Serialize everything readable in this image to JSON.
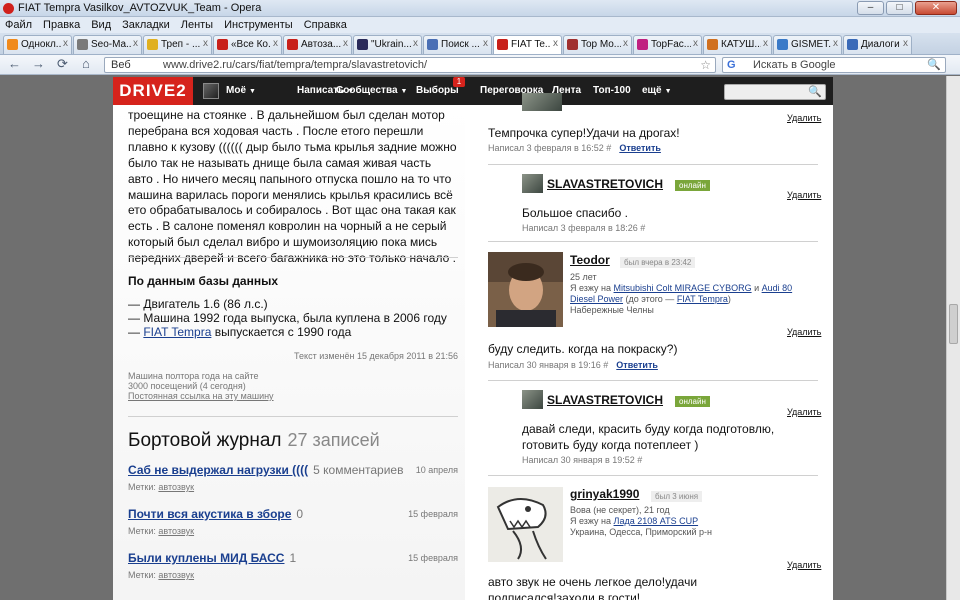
{
  "window": {
    "title": "FIAT Tempra Vasilkov_AVTOZVUK_Team - Opera",
    "min": "–",
    "max": "□",
    "close": "✕"
  },
  "menu": [
    "Файл",
    "Правка",
    "Вид",
    "Закладки",
    "Ленты",
    "Инструменты",
    "Справка"
  ],
  "tabs": [
    {
      "label": "Однокл...",
      "color": "#f08a1c"
    },
    {
      "label": "Seo-Ma...",
      "color": "#7a7a7a"
    },
    {
      "label": "Треп - ...",
      "color": "#e0b020"
    },
    {
      "label": "«Все Ко...",
      "color": "#c8201a"
    },
    {
      "label": "Автоза...",
      "color": "#c8201a"
    },
    {
      "label": "\"Ukrain...",
      "color": "#2a2a5a"
    },
    {
      "label": "Поиск ...",
      "color": "#4a6fb5"
    },
    {
      "label": "FIAT Te...",
      "color": "#c8201a",
      "active": true
    },
    {
      "label": "Top Mo...",
      "color": "#a03030"
    },
    {
      "label": "TopFac...",
      "color": "#c02080"
    },
    {
      "label": "КАТУШ...",
      "color": "#d07020"
    },
    {
      "label": "GISMET...",
      "color": "#3a7ac8"
    },
    {
      "label": "Диалоги",
      "color": "#3a6ab8"
    }
  ],
  "tab_close": "x",
  "addr": {
    "back": "←",
    "forward": "→",
    "reload": "⟳",
    "home": "⌂",
    "web_label": "Веб",
    "url": "www.drive2.ru/cars/fiat/tempra/tempra/slavastretovich/",
    "star": "☆"
  },
  "gsearch": {
    "engine": "G",
    "placeholder": "Искать в Google",
    "icon": "🔍"
  },
  "site_nav": {
    "logo": "DRIVE2",
    "items": [
      {
        "label": "Моё",
        "dropdown": true
      },
      {
        "label": "Написать",
        "dropdown": true
      },
      {
        "label": "Сообщества",
        "dropdown": true
      },
      {
        "label": "Выборы",
        "dropdown": false
      },
      {
        "label": "Переговорка",
        "dropdown": false
      },
      {
        "label": "Лента",
        "dropdown": false
      },
      {
        "label": "Топ-100",
        "dropdown": false
      },
      {
        "label": "ещё",
        "dropdown": true
      }
    ],
    "badge": "1",
    "caret": "▼",
    "search_icon": "🔍"
  },
  "left": {
    "description": "троещине на стоянке . В дальнейшом был сделан мотор перебрана вся ходовая часть . После етого перешли плавно к кузову (((((( дыр было тьма крылья задние можно было так не называть днище была самая живая часть авто . Но ничего месяц папыного отпуска пошло на то что машина варилась пороги менялись крылья красились всё ето обрабатывалось и собиралось . Вот щас она такая как есть . В салоне поменял ковролин на чорный а не серый который был сделал вибро и шумоизоляцию пока мись передних дверей и всего багажника но это только начало .",
    "db_heading": "По данным базы данных",
    "db_engine": "— Двигатель 1.6 (86 л.с.)",
    "db_year": "— Машина 1992 года выпуска, была куплена в 2006 году",
    "db_prod_dash": "— ",
    "db_prod_link": "FIAT Tempra",
    "db_prod_rest": " выпускается с 1990 года",
    "edited": "Текст изменён 15 декабря 2011 в 21:56",
    "stat1": "Машина полтора года на сайте",
    "stat2": "3000 посещений (4 сегодня)",
    "permalink": "Постоянная ссылка на эту машину",
    "journal_title": "Бортовой журнал",
    "journal_count": "27 записей",
    "posts": [
      {
        "title": "Саб не выдержал нагрузки ((((",
        "comments": "5 комментариев",
        "date": "10 апреля",
        "tags_label": "Метки: ",
        "tag": "автозвук"
      },
      {
        "title": "Почти вся акустика в зборе",
        "comments": "0",
        "date": "15 февраля",
        "tags_label": "Метки: ",
        "tag": "автозвук"
      },
      {
        "title": "Были куплены МИД БАСС",
        "comments": "1",
        "date": "15 февраля",
        "tags_label": "Метки: ",
        "tag": "автозвук"
      }
    ]
  },
  "right": {
    "delete": "Удалить",
    "reply": "Ответить",
    "c1": {
      "text": "Темпрочка супер!Удачи на дрогах!",
      "meta": "Написал 3 февраля в 16:52 #"
    },
    "c2": {
      "user": "SLAVASTRETOVICH",
      "status": "онлайн",
      "text": "Большое спасибо .",
      "meta": "Написал 3 февраля в 18:26 #"
    },
    "c3": {
      "user": "Teodor",
      "status": "был вчера в 23:42",
      "age": "25 лет",
      "drives": "Я езжу на ",
      "car1": "Mitsubishi Colt MIRAGE CYBORG",
      "and": " и ",
      "car2": "Audi 80 Diesel Power",
      "before": " (до этого — ",
      "car3": "FIAT Tempra",
      "before_end": ")",
      "city": "Набережные Челны",
      "text": "буду следить. когда на покраску?)",
      "meta": "Написал 30 января в 19:16 #"
    },
    "c4": {
      "user": "SLAVASTRETOVICH",
      "status": "онлайн",
      "text": "давай следи, красить буду когда подготовлю, готовить буду когда потеплеет )",
      "meta": "Написал 30 января в 19:52 #"
    },
    "c5": {
      "user": "grinyak1990",
      "status": "был 3 июня",
      "name": "Вова (не секрет), 21 год",
      "drives": "Я езжу на ",
      "car": "Лада 2108 ATS CUP",
      "loc": "Украина, Одесса, Приморский р-н",
      "text": "авто звук не очень легкое дело!удачи подписался!заходи в гости!"
    }
  }
}
